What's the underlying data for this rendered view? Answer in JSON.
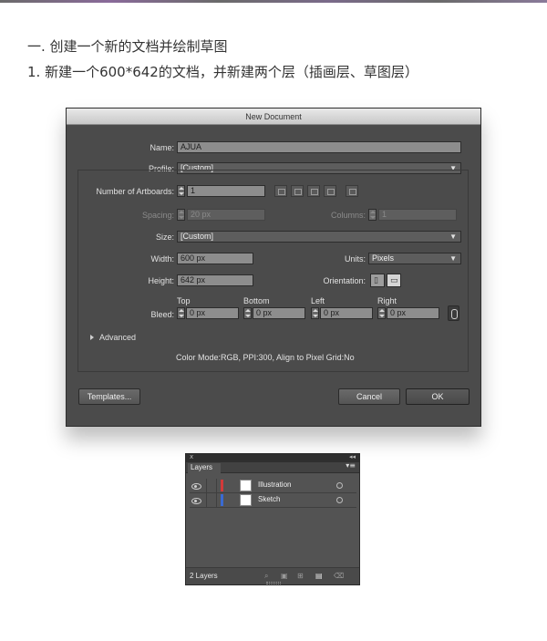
{
  "article": {
    "step_heading": "一. 创建一个新的文档并绘制草图",
    "substep": "1. 新建一个600*642的文档，并新建两个层（插画层、草图层）"
  },
  "dialog": {
    "title": "New Document",
    "name_label": "Name:",
    "name_value": "AJUA",
    "profile_label": "Profile:",
    "profile_value": "[Custom]",
    "artboards_label": "Number of Artboards:",
    "artboards_value": "1",
    "spacing_label": "Spacing:",
    "spacing_value": "20 px",
    "columns_label": "Columns:",
    "columns_value": "1",
    "size_label": "Size:",
    "size_value": "[Custom]",
    "width_label": "Width:",
    "width_value": "600 px",
    "units_label": "Units:",
    "units_value": "Pixels",
    "height_label": "Height:",
    "height_value": "642 px",
    "orientation_label": "Orientation:",
    "bleed_label": "Bleed:",
    "bleed_top_label": "Top",
    "bleed_bottom_label": "Bottom",
    "bleed_left_label": "Left",
    "bleed_right_label": "Right",
    "bleed_top_value": "0 px",
    "bleed_bottom_value": "0 px",
    "bleed_left_value": "0 px",
    "bleed_right_value": "0 px",
    "advanced_label": "Advanced",
    "info_text": "Color Mode:RGB, PPI:300, Align to Pixel Grid:No",
    "templates_button": "Templates...",
    "cancel_button": "Cancel",
    "ok_button": "OK"
  },
  "layers_panel": {
    "close_glyph": "x",
    "collapse_glyph": "◂◂",
    "tab_label": "Layers",
    "menu_glyph": "▾≡",
    "layers": [
      {
        "name": "Illustration",
        "color": "#d23a3a"
      },
      {
        "name": "Sketch",
        "color": "#3a6ad2"
      }
    ],
    "count_text": "2 Layers"
  },
  "colors": {
    "dialog_bg": "#4b4b4b",
    "panel_bg": "#535353"
  }
}
